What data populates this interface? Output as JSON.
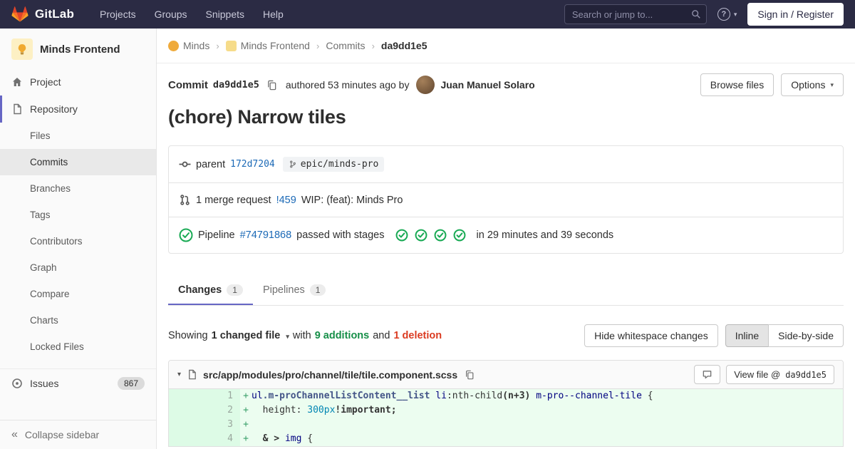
{
  "colors": {
    "navbar_bg": "#2b2b44",
    "accent_indigo": "#6666c4",
    "link_blue": "#1b69b6",
    "success_green": "#1aaa55",
    "danger_red": "#db3b21",
    "addition_bg": "#ecfdf0",
    "brand_orange": "#fc6d26"
  },
  "icons": {
    "caret_down": "▾",
    "collapse": "«",
    "help": "?"
  },
  "navbar": {
    "brand": "GitLab",
    "menu": [
      "Projects",
      "Groups",
      "Snippets",
      "Help"
    ],
    "search_placeholder": "Search or jump to...",
    "sign_in_label": "Sign in / Register"
  },
  "sidebar": {
    "project_name": "Minds Frontend",
    "project_item": "Project",
    "repository": {
      "label": "Repository",
      "items": [
        {
          "label": "Files"
        },
        {
          "label": "Commits",
          "active": true
        },
        {
          "label": "Branches"
        },
        {
          "label": "Tags"
        },
        {
          "label": "Contributors"
        },
        {
          "label": "Graph"
        },
        {
          "label": "Compare"
        },
        {
          "label": "Charts"
        },
        {
          "label": "Locked Files"
        }
      ]
    },
    "issues": {
      "label": "Issues",
      "count": "867"
    },
    "collapse_label": "Collapse sidebar"
  },
  "breadcrumb": {
    "separator": "›",
    "items": [
      {
        "label": "Minds",
        "avatar": "av-group"
      },
      {
        "label": "Minds Frontend",
        "avatar": "av-project"
      },
      {
        "label": "Commits"
      },
      {
        "label": "da9dd1e5",
        "current": true
      }
    ]
  },
  "commit": {
    "label": "Commit",
    "sha": "da9dd1e5",
    "authored_text": "authored 53 minutes ago by",
    "author": "Juan Manuel Solaro",
    "browse_files": "Browse files",
    "options": "Options",
    "title": "(chore) Narrow tiles",
    "parent_label": "parent",
    "parent_sha": "172d7204",
    "ref": "epic/minds-pro",
    "mr_count_text": "1 merge request",
    "mr_id": "!459",
    "mr_title": "WIP: (feat): Minds Pro",
    "pipeline_label": "Pipeline",
    "pipeline_id": "#74791868",
    "pipeline_status": "passed with stages",
    "stages": [
      "passed",
      "passed",
      "passed",
      "passed"
    ],
    "pipeline_duration": "in 29 minutes and 39 seconds"
  },
  "tabs": [
    {
      "label": "Changes",
      "count": "1",
      "active": true
    },
    {
      "label": "Pipelines",
      "count": "1"
    }
  ],
  "diffbar": {
    "showing": "Showing",
    "changed": "1 changed file",
    "with_text": "with",
    "additions": "9 additions",
    "and_text": "and",
    "deletions": "1 deletion",
    "hide_whitespace": "Hide whitespace changes",
    "inline": "Inline",
    "side_by_side": "Side-by-side"
  },
  "file": {
    "path": "src/app/modules/pro/channel/tile/tile.component.scss",
    "view_file_label": "View file @",
    "view_file_sha": "da9dd1e5",
    "lines": [
      {
        "old": "",
        "new": "1",
        "sign": "+",
        "segments": [
          {
            "t": "ul",
            "c": "nt"
          },
          {
            "t": ".m-proChannelListContent__list",
            "c": "nc"
          },
          {
            "t": " ",
            "c": ""
          },
          {
            "t": "li",
            "c": "nt"
          },
          {
            "t": ":nth-child",
            "c": ""
          },
          {
            "t": "(n+3)",
            "c": "o"
          },
          {
            "t": " ",
            "c": ""
          },
          {
            "t": "m-pro--channel-tile",
            "c": "nt"
          },
          {
            "t": " {",
            "c": ""
          }
        ]
      },
      {
        "old": "",
        "new": "2",
        "sign": "+",
        "segments": [
          {
            "t": "  height: ",
            "c": ""
          },
          {
            "t": "300px",
            "c": "m"
          },
          {
            "t": "!important;",
            "c": "o"
          }
        ]
      },
      {
        "old": "",
        "new": "3",
        "sign": "+",
        "segments": []
      },
      {
        "old": "",
        "new": "4",
        "sign": "+",
        "segments": [
          {
            "t": "  ",
            "c": ""
          },
          {
            "t": "& > ",
            "c": "o"
          },
          {
            "t": "img",
            "c": "nt"
          },
          {
            "t": " {",
            "c": ""
          }
        ]
      }
    ]
  }
}
